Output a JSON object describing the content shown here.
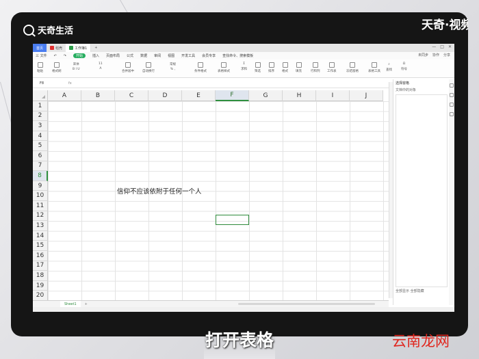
{
  "branding": {
    "logo_text": "天奇生活",
    "watermark_top_right": "天奇·视频",
    "watermark_bottom_right": "云南龙网"
  },
  "caption": "打开表格",
  "app": {
    "tabs": [
      {
        "label": "首页",
        "active": false
      },
      {
        "label": "稻壳",
        "active": false
      },
      {
        "label": "工作簿1",
        "active": true
      }
    ],
    "menu": {
      "file_label": "三 文件",
      "items": [
        "开始",
        "插入",
        "页面布局",
        "公式",
        "数据",
        "审阅",
        "视图",
        "开发工具",
        "会员专享",
        "查找命令、搜索模板"
      ],
      "active_item": "开始",
      "right_items": [
        "未同步",
        "协作",
        "分享"
      ]
    },
    "ribbon": {
      "groups": [
        "粘贴",
        "格式刷",
        "宋体",
        "11",
        "合并居中",
        "自动换行",
        "常规",
        "条件格式",
        "表格样式",
        "求和",
        "筛选",
        "排序",
        "格式",
        "填充",
        "行和列",
        "工作表",
        "冻结窗格",
        "表格工具",
        "查找",
        "符号"
      ]
    },
    "formula_bar": {
      "name_box": "F8",
      "fx_label": "fx"
    },
    "sheet": {
      "columns": [
        "A",
        "B",
        "C",
        "D",
        "E",
        "F",
        "G",
        "H",
        "I",
        "J"
      ],
      "rows": [
        "1",
        "2",
        "3",
        "4",
        "5",
        "6",
        "7",
        "8",
        "9",
        "10",
        "11",
        "12",
        "13",
        "14",
        "15",
        "16",
        "17",
        "18",
        "19",
        "20"
      ],
      "selected_column": "F",
      "selected_row": "8",
      "cell_text": "信仰不应该依附于任何一个人",
      "sheet_tab": "Sheet1",
      "add_sheet": "+"
    },
    "side_pane": {
      "title": "选择窗格",
      "item": "文档中的对象",
      "footer": "全部显示   全部隐藏"
    }
  }
}
